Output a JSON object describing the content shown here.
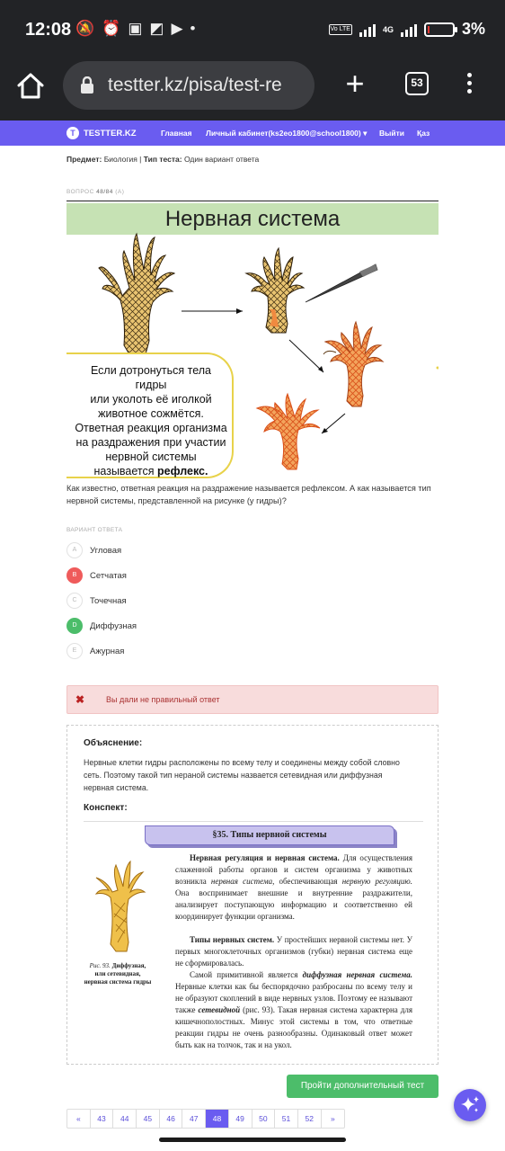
{
  "status_bar": {
    "time": "12:08",
    "icons": [
      "mute-icon",
      "alarm-icon",
      "sim-icon",
      "gallery-icon",
      "youtube-icon"
    ],
    "volte": "Vo LTE",
    "network": "4G",
    "battery_percent": "3%",
    "battery_level": 0.03,
    "battery_color": "#e53935"
  },
  "browser": {
    "url": "testter.kz/pisa/test-re",
    "tab_count": "53"
  },
  "site_nav": {
    "brand": "TESTTER.KZ",
    "links": [
      "Главная",
      "Личный кабинет(ks2eo1800@school1800)",
      "Выйти",
      "Қаз"
    ],
    "accent_color": "#6a5cf0"
  },
  "test_meta": {
    "subject_label": "Предмет:",
    "subject": "Биология",
    "type_label": "Тип теста:",
    "type": "Один вариант ответа",
    "question_label": "ВОПРОС",
    "question_number": "48/84",
    "question_tag": "(А)"
  },
  "question_image": {
    "title": "Нервная система",
    "callout_lines": [
      "Если дотронуться тела гидры",
      "или уколоть её иголкой",
      "животное сожмётся.",
      "Ответная реакция организма",
      "на раздражения при участии",
      "нервной системы",
      "называется"
    ],
    "callout_bold": "рефлекс."
  },
  "question_text": "Как известно, ответная реакция на раздражение называется рефлексом. А как называется тип нервной системы, представленной на рисунке (у гидры)?",
  "answers": {
    "heading": "ВАРИАНТ ОТВЕТА",
    "options": [
      {
        "letter": "A",
        "label": "Угловая",
        "state": "none"
      },
      {
        "letter": "B",
        "label": "Сетчатая",
        "state": "wrong"
      },
      {
        "letter": "C",
        "label": "Точечная",
        "state": "none"
      },
      {
        "letter": "D",
        "label": "Диффузная",
        "state": "correct"
      },
      {
        "letter": "E",
        "label": "Ажурная",
        "state": "none"
      }
    ],
    "wrong_color": "#ef5b5b",
    "correct_color": "#4cbd6a"
  },
  "alert": {
    "icon": "close-icon",
    "message": "Вы дали не правильный ответ"
  },
  "explanation": {
    "heading": "Объяснение:",
    "text": "Нервные клетки гидры расположены по всему телу и соединены между собой словно сеть. Поэтому такой тип нерaной системы назвается сетевидная или диффузная нервная система.",
    "notes_heading": "Конспект:"
  },
  "textbook": {
    "section_title": "§35. Типы нервной системы",
    "figure_caption_prefix": "Рис. 93.",
    "figure_caption": "Диффузная, или сетевидная, нервная система гидры",
    "p1_bold": "Нервная регуляция и нервная система.",
    "p1_a": "Для осуществления слаженной работы органов и систем организма у животных возникла",
    "p1_italic1": "нервная система,",
    "p1_b": "обеспечивающая",
    "p1_italic2": "нервную регуляцию.",
    "p1_c": "Она воспринимает внешние и внутренние раздражители, анализирует поступающую информацию и соответственно ей координирует функции организма.",
    "p2_bold": "Типы нервных систем.",
    "p2": "У простейших нервной системы нет. У первых многоклеточных организмов (губки) нервная система еще не сформировалась.",
    "p3_a": "Самой примитивной является",
    "p3_bold_italic": "диффузная нервная система.",
    "p3_b": "Нервные клетки как бы беспорядочно разбросаны по всему телу и не образуют скоплений в виде нервных узлов. Поэтому ее называют также",
    "p3_bold_italic2": "сетевидной",
    "p3_c": "(рис. 93). Такая нервная система характерна для кишечнополостных. Минус этой системы в том, что ответные реакции гидры не очень разнообразны. Одинаковый ответ может быть как на толчок, так и на укол."
  },
  "extra_test_button": "Пройти дополнительный тест",
  "pagination": {
    "prev": "«",
    "pages": [
      "43",
      "44",
      "45",
      "46",
      "47",
      "48",
      "49",
      "50",
      "51",
      "52"
    ],
    "active": "48",
    "next": "»"
  }
}
